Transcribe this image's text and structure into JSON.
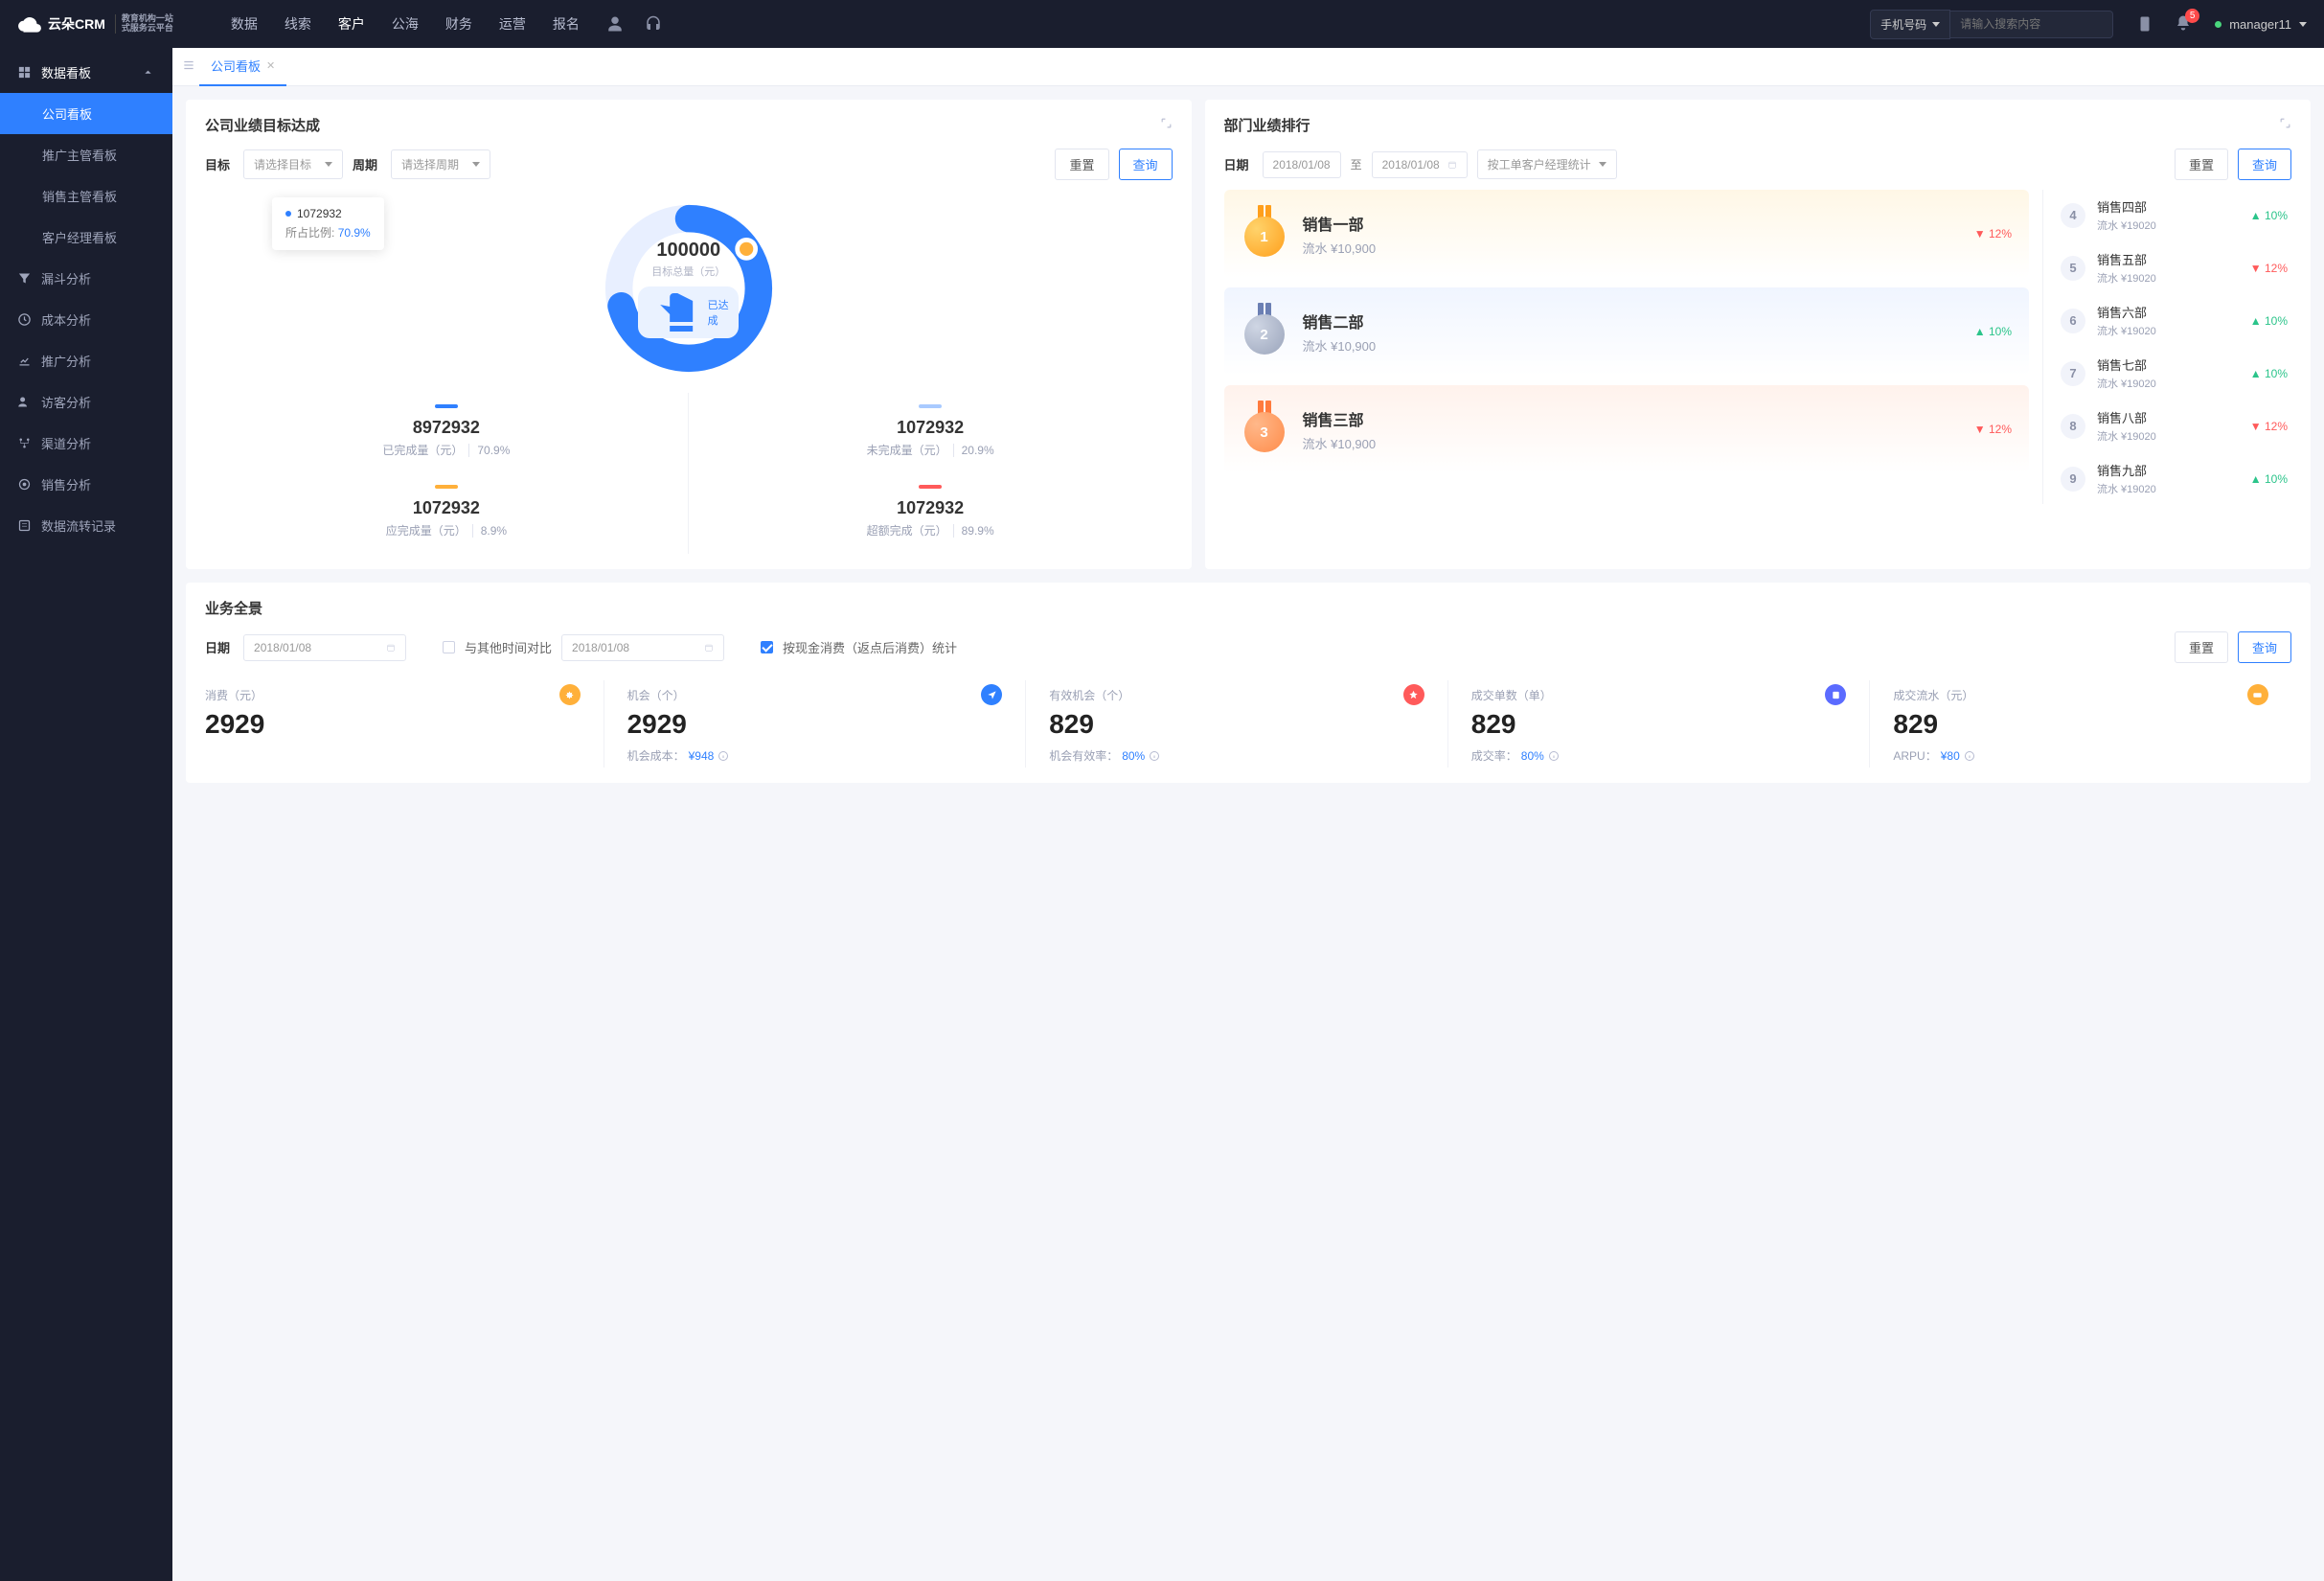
{
  "brand": {
    "name": "云朵CRM",
    "sub1": "教育机构一站",
    "sub2": "式服务云平台"
  },
  "topnav": {
    "items": [
      "数据",
      "线索",
      "客户",
      "公海",
      "财务",
      "运营",
      "报名"
    ],
    "searchType": "手机号码",
    "searchPlaceholder": "请输入搜索内容",
    "notifCount": "5",
    "user": "manager11"
  },
  "sidebar": {
    "group": "数据看板",
    "subs": [
      "公司看板",
      "推广主管看板",
      "销售主管看板",
      "客户经理看板"
    ],
    "items": [
      "漏斗分析",
      "成本分析",
      "推广分析",
      "访客分析",
      "渠道分析",
      "销售分析",
      "数据流转记录"
    ]
  },
  "tab": {
    "label": "公司看板"
  },
  "target": {
    "title": "公司业绩目标达成",
    "labelTarget": "目标",
    "selTarget": "请选择目标",
    "labelPeriod": "周期",
    "selPeriod": "请选择周期",
    "btnReset": "重置",
    "btnQuery": "查询",
    "donut": {
      "total": "100000",
      "totalLabel": "目标总量（元）",
      "pill": "已达成"
    },
    "tip": {
      "value": "1072932",
      "ratioLabel": "所占比例:",
      "ratio": "70.9%"
    },
    "metrics": [
      {
        "color": "#2f80ff",
        "value": "8972932",
        "label": "已完成量（元）",
        "pct": "70.9%"
      },
      {
        "color": "#a9caff",
        "value": "1072932",
        "label": "未完成量（元）",
        "pct": "20.9%"
      },
      {
        "color": "#ffb03a",
        "value": "1072932",
        "label": "应完成量（元）",
        "pct": "8.9%"
      },
      {
        "color": "#ff5a5a",
        "value": "1072932",
        "label": "超额完成（元）",
        "pct": "89.9%"
      }
    ]
  },
  "rank": {
    "title": "部门业绩排行",
    "labelDate": "日期",
    "date1": "2018/01/08",
    "dateSep": "至",
    "date2": "2018/01/08",
    "selectBy": "按工单客户经理统计",
    "btnReset": "重置",
    "btnQuery": "查询",
    "podium": [
      {
        "num": "1",
        "name": "销售一部",
        "flow": "流水 ¥10,900",
        "dir": "down",
        "pct": "12%"
      },
      {
        "num": "2",
        "name": "销售二部",
        "flow": "流水 ¥10,900",
        "dir": "up",
        "pct": "10%"
      },
      {
        "num": "3",
        "name": "销售三部",
        "flow": "流水 ¥10,900",
        "dir": "down",
        "pct": "12%"
      }
    ],
    "list": [
      {
        "num": "4",
        "name": "销售四部",
        "flow": "流水 ¥19020",
        "dir": "up",
        "pct": "10%"
      },
      {
        "num": "5",
        "name": "销售五部",
        "flow": "流水 ¥19020",
        "dir": "down",
        "pct": "12%"
      },
      {
        "num": "6",
        "name": "销售六部",
        "flow": "流水 ¥19020",
        "dir": "up",
        "pct": "10%"
      },
      {
        "num": "7",
        "name": "销售七部",
        "flow": "流水 ¥19020",
        "dir": "up",
        "pct": "10%"
      },
      {
        "num": "8",
        "name": "销售八部",
        "flow": "流水 ¥19020",
        "dir": "down",
        "pct": "12%"
      },
      {
        "num": "9",
        "name": "销售九部",
        "flow": "流水 ¥19020",
        "dir": "up",
        "pct": "10%"
      }
    ]
  },
  "overview": {
    "title": "业务全景",
    "labelDate": "日期",
    "date1": "2018/01/08",
    "compareLabel": "与其他时间对比",
    "date2": "2018/01/08",
    "checkLabel": "按现金消费（返点后消费）统计",
    "btnReset": "重置",
    "btnQuery": "查询",
    "kpis": [
      {
        "label": "消费（元）",
        "value": "2929",
        "subLabel": "",
        "subVal": "",
        "iconBg": "#ffb03a"
      },
      {
        "label": "机会（个）",
        "value": "2929",
        "subLabel": "机会成本：",
        "subVal": "¥948",
        "iconBg": "#2f80ff"
      },
      {
        "label": "有效机会（个）",
        "value": "829",
        "subLabel": "机会有效率：",
        "subVal": "80%",
        "iconBg": "#ff5a5a"
      },
      {
        "label": "成交单数（单）",
        "value": "829",
        "subLabel": "成交率：",
        "subVal": "80%",
        "iconBg": "#5b6bff"
      },
      {
        "label": "成交流水（元）",
        "value": "829",
        "subLabel": "ARPU：",
        "subVal": "¥80",
        "iconBg": "#ffb03a"
      }
    ]
  },
  "chart_data": {
    "type": "pie",
    "title": "目标总量（元）",
    "total": 100000,
    "series": [
      {
        "name": "已完成量（元）",
        "value": 8972932,
        "pct": 70.9,
        "color": "#2f80ff"
      },
      {
        "name": "未完成量（元）",
        "value": 1072932,
        "pct": 20.9,
        "color": "#a9caff"
      },
      {
        "name": "应完成量（元）",
        "value": 1072932,
        "pct": 8.9,
        "color": "#ffb03a"
      },
      {
        "name": "超额完成（元）",
        "value": 1072932,
        "pct": 89.9,
        "color": "#ff5a5a"
      }
    ],
    "tooltip": {
      "value": 1072932,
      "ratio": 70.9
    }
  }
}
